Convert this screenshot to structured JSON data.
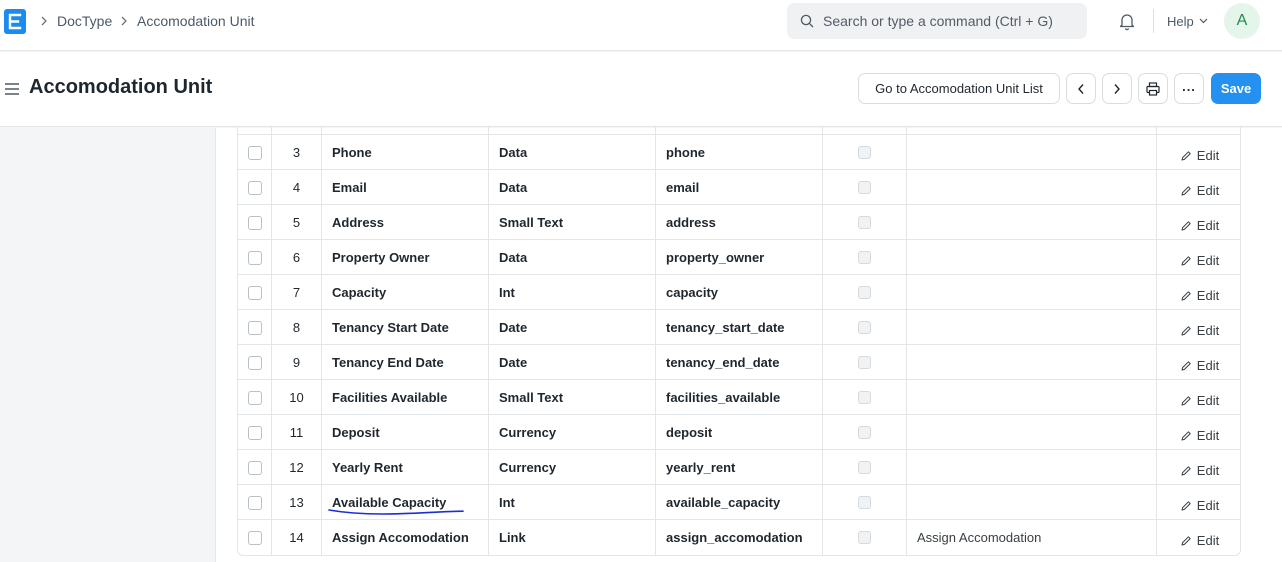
{
  "navbar": {
    "logo_letter": "E",
    "breadcrumbs": [
      "DocType",
      "Accomodation Unit"
    ],
    "search_placeholder": "Search or type a command (Ctrl + G)",
    "help_label": "Help",
    "avatar_initial": "A"
  },
  "page": {
    "title": "Accomodation Unit",
    "go_to_list_label": "Go to Accomodation Unit List",
    "save_label": "Save",
    "more_label": "..."
  },
  "fields_table": {
    "edit_label": "Edit",
    "rows": [
      {
        "idx": "3",
        "label": "Phone",
        "type": "Data",
        "fieldname": "phone",
        "options": ""
      },
      {
        "idx": "4",
        "label": "Email",
        "type": "Data",
        "fieldname": "email",
        "options": ""
      },
      {
        "idx": "5",
        "label": "Address",
        "type": "Small Text",
        "fieldname": "address",
        "options": ""
      },
      {
        "idx": "6",
        "label": "Property Owner",
        "type": "Data",
        "fieldname": "property_owner",
        "options": ""
      },
      {
        "idx": "7",
        "label": "Capacity",
        "type": "Int",
        "fieldname": "capacity",
        "options": ""
      },
      {
        "idx": "8",
        "label": "Tenancy Start Date",
        "type": "Date",
        "fieldname": "tenancy_start_date",
        "options": ""
      },
      {
        "idx": "9",
        "label": "Tenancy End Date",
        "type": "Date",
        "fieldname": "tenancy_end_date",
        "options": ""
      },
      {
        "idx": "10",
        "label": "Facilities Available",
        "type": "Small Text",
        "fieldname": "facilities_available",
        "options": ""
      },
      {
        "idx": "11",
        "label": "Deposit",
        "type": "Currency",
        "fieldname": "deposit",
        "options": ""
      },
      {
        "idx": "12",
        "label": "Yearly Rent",
        "type": "Currency",
        "fieldname": "yearly_rent",
        "options": ""
      },
      {
        "idx": "13",
        "label": "Available Capacity",
        "type": "Int",
        "fieldname": "available_capacity",
        "options": ""
      },
      {
        "idx": "14",
        "label": "Assign Accomodation",
        "type": "Link",
        "fieldname": "assign_accomodation",
        "options": "Assign Accomodation"
      }
    ]
  },
  "colors": {
    "primary": "#2490ef",
    "annotation_pen": "#1c2fd1"
  }
}
